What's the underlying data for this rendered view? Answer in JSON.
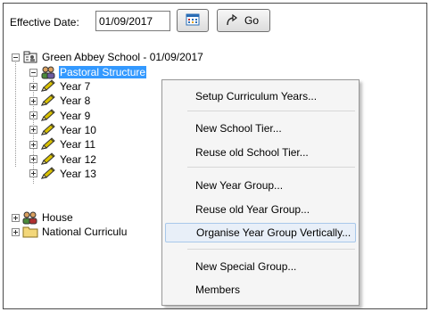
{
  "toolbar": {
    "effective_date_label": "Effective Date:",
    "effective_date_value": "01/09/2017",
    "go_label": "Go"
  },
  "tree": {
    "root": "Green Abbey School - 01/09/2017",
    "pastoral": "Pastoral Structure",
    "years": [
      "Year 7",
      "Year 8",
      "Year 9",
      "Year 10",
      "Year 11",
      "Year 12",
      "Year 13"
    ],
    "house": "House",
    "national": "National Curriculu"
  },
  "menu": {
    "items": [
      "Setup Curriculum Years...",
      "New School Tier...",
      "Reuse old School Tier...",
      "New Year Group...",
      "Reuse old Year Group...",
      "Organise Year Group Vertically...",
      "New Special Group...",
      "Members"
    ],
    "highlighted": "Organise Year Group Vertically..."
  },
  "colors": {
    "selection": "#3399ff",
    "menu_highlight": "#e8eff8",
    "menu_highlight_border": "#a8c8ea"
  }
}
